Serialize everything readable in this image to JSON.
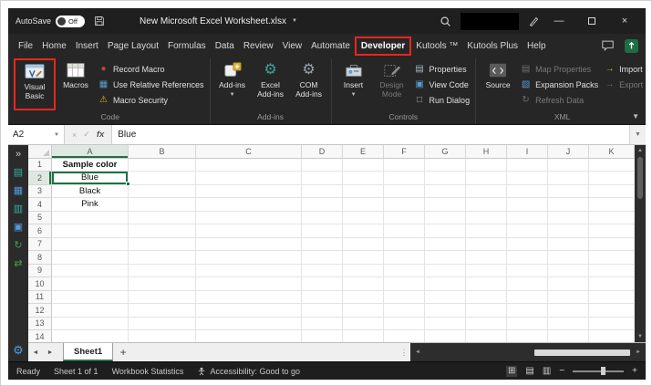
{
  "colors": {
    "annotation_red": "#e8261d",
    "excel_green": "#217346",
    "selection_green": "#1a7340",
    "warning_yellow": "#e8b53a"
  },
  "title_bar": {
    "autosave_label": "AutoSave",
    "autosave_state": "Off",
    "document_title": "New Microsoft Excel Worksheet.xlsx"
  },
  "ribbon_tabs": {
    "items": [
      "File",
      "Home",
      "Insert",
      "Page Layout",
      "Formulas",
      "Data",
      "Review",
      "View",
      "Automate",
      "Developer",
      "Kutools ™",
      "Kutools Plus",
      "Help"
    ],
    "active": "Developer"
  },
  "ribbon": {
    "code": {
      "label": "Code",
      "visual_basic": "Visual Basic",
      "macros": "Macros",
      "record_macro": "Record Macro",
      "use_relative_references": "Use Relative References",
      "macro_security": "Macro Security"
    },
    "addins": {
      "label": "Add-ins",
      "add_ins": "Add-ins",
      "excel_add_ins": "Excel Add-ins",
      "com_add_ins": "COM Add-ins"
    },
    "controls": {
      "label": "Controls",
      "insert": "Insert",
      "design_mode": "Design Mode",
      "properties": "Properties",
      "view_code": "View Code",
      "run_dialog": "Run Dialog"
    },
    "xml": {
      "label": "XML",
      "source": "Source",
      "map_properties": "Map Properties",
      "expansion_packs": "Expansion Packs",
      "refresh_data": "Refresh Data",
      "import": "Import",
      "export": "Export"
    }
  },
  "formula_bar": {
    "name_box": "A2",
    "function_label": "fx",
    "content": "Blue"
  },
  "grid": {
    "columns": [
      "A",
      "B",
      "C",
      "D",
      "E",
      "F",
      "G",
      "H",
      "I",
      "J",
      "K"
    ],
    "rows": [
      "1",
      "2",
      "3",
      "4",
      "5",
      "6",
      "7",
      "8",
      "9",
      "10",
      "11",
      "12",
      "13",
      "14"
    ],
    "cells": [
      {
        "ref": "A1",
        "value": "Sample color",
        "bold": true
      },
      {
        "ref": "A2",
        "value": "Blue"
      },
      {
        "ref": "A3",
        "value": "Black"
      },
      {
        "ref": "A4",
        "value": "Pink"
      }
    ],
    "selected_cell": "A2"
  },
  "sidebar": {
    "icons": [
      {
        "name": "expand-pane-icon",
        "glyph": "»",
        "color": "#c9c9c9"
      },
      {
        "name": "kutools-workbook-pane-icon",
        "glyph": "▤",
        "color": "#35b0a0"
      },
      {
        "name": "kutools-worksheet-pane-icon",
        "glyph": "▦",
        "color": "#4f9ddd"
      },
      {
        "name": "kutools-resources-pane-icon",
        "glyph": "▥",
        "color": "#35b0a0"
      },
      {
        "name": "kutools-column-pane-icon",
        "glyph": "▣",
        "color": "#4f9ddd"
      },
      {
        "name": "kutools-refresh-pane-icon",
        "glyph": "↻",
        "color": "#43a047"
      },
      {
        "name": "kutools-sync-pane-icon",
        "glyph": "⇄",
        "color": "#43a047"
      },
      {
        "name": "settings-gear-icon",
        "glyph": "⚙",
        "color": "#4f9ddd",
        "bottom": true
      }
    ]
  },
  "sheet_tabs": {
    "active_tab": "Sheet1",
    "new_sheet_label": "+"
  },
  "status_bar": {
    "mode": "Ready",
    "sheet_count": "Sheet 1 of 1",
    "workbook_statistics": "Workbook Statistics",
    "accessibility": "Accessibility: Good to go"
  }
}
